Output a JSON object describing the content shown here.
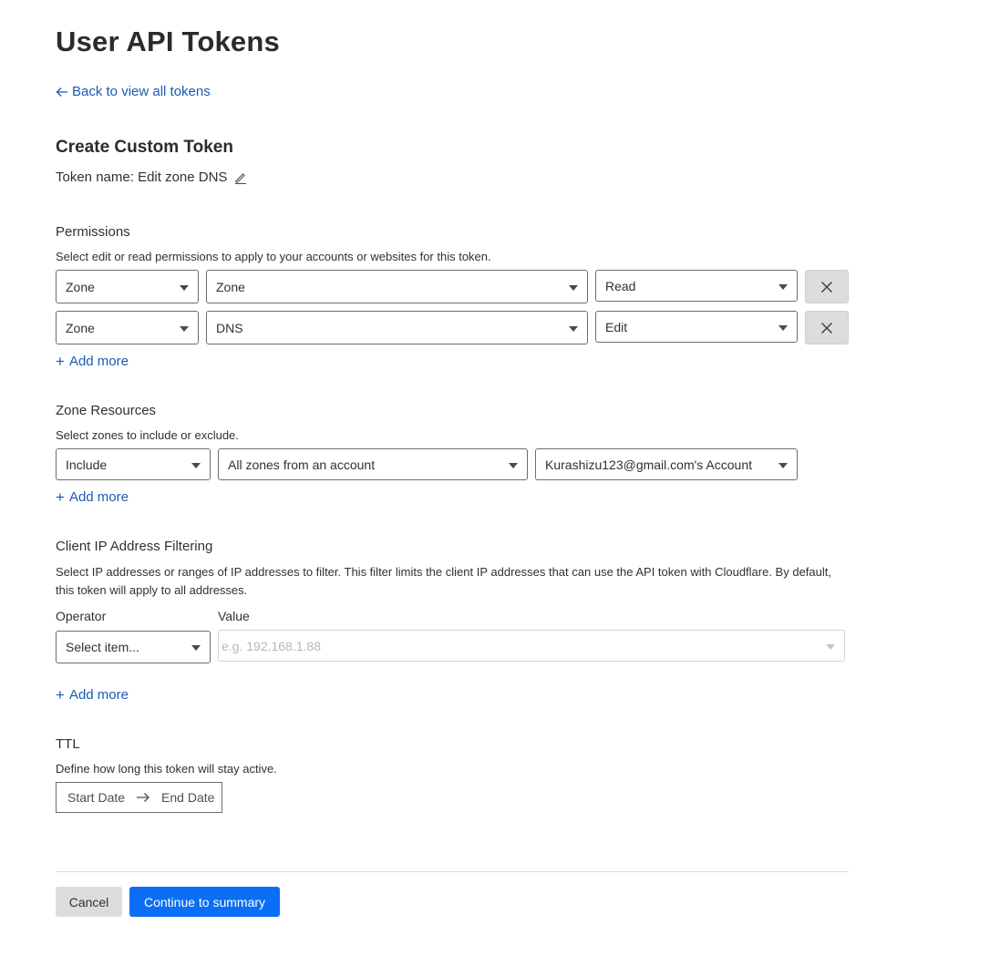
{
  "page": {
    "title": "User API Tokens",
    "back_link": "Back to view all tokens",
    "section_title": "Create Custom Token",
    "token_name_label": "Token name:",
    "token_name_value": "Edit zone DNS"
  },
  "permissions": {
    "title": "Permissions",
    "description": "Select edit or read permissions to apply to your accounts or websites for this token.",
    "rows": [
      {
        "scope": "Zone",
        "resource": "Zone",
        "access": "Read"
      },
      {
        "scope": "Zone",
        "resource": "DNS",
        "access": "Edit"
      }
    ],
    "add_more": "Add more"
  },
  "zone_resources": {
    "title": "Zone Resources",
    "description": "Select zones to include or exclude.",
    "rows": [
      {
        "mode": "Include",
        "target": "All zones from an account",
        "account": "Kurashizu123@gmail.com's Account"
      }
    ],
    "add_more": "Add more"
  },
  "ip_filtering": {
    "title": "Client IP Address Filtering",
    "description": "Select IP addresses or ranges of IP addresses to filter. This filter limits the client IP addresses that can use the API token with Cloudflare. By default, this token will apply to all addresses.",
    "operator_label": "Operator",
    "value_label": "Value",
    "operator_placeholder": "Select item...",
    "value_placeholder": "e.g. 192.168.1.88",
    "add_more": "Add more"
  },
  "ttl": {
    "title": "TTL",
    "description": "Define how long this token will stay active.",
    "start_date": "Start Date",
    "end_date": "End Date"
  },
  "actions": {
    "cancel": "Cancel",
    "continue": "Continue to summary"
  },
  "colors": {
    "link": "#1b5bb5",
    "primary_button": "#0a6ff4",
    "secondary_button": "#dcdcdc"
  }
}
